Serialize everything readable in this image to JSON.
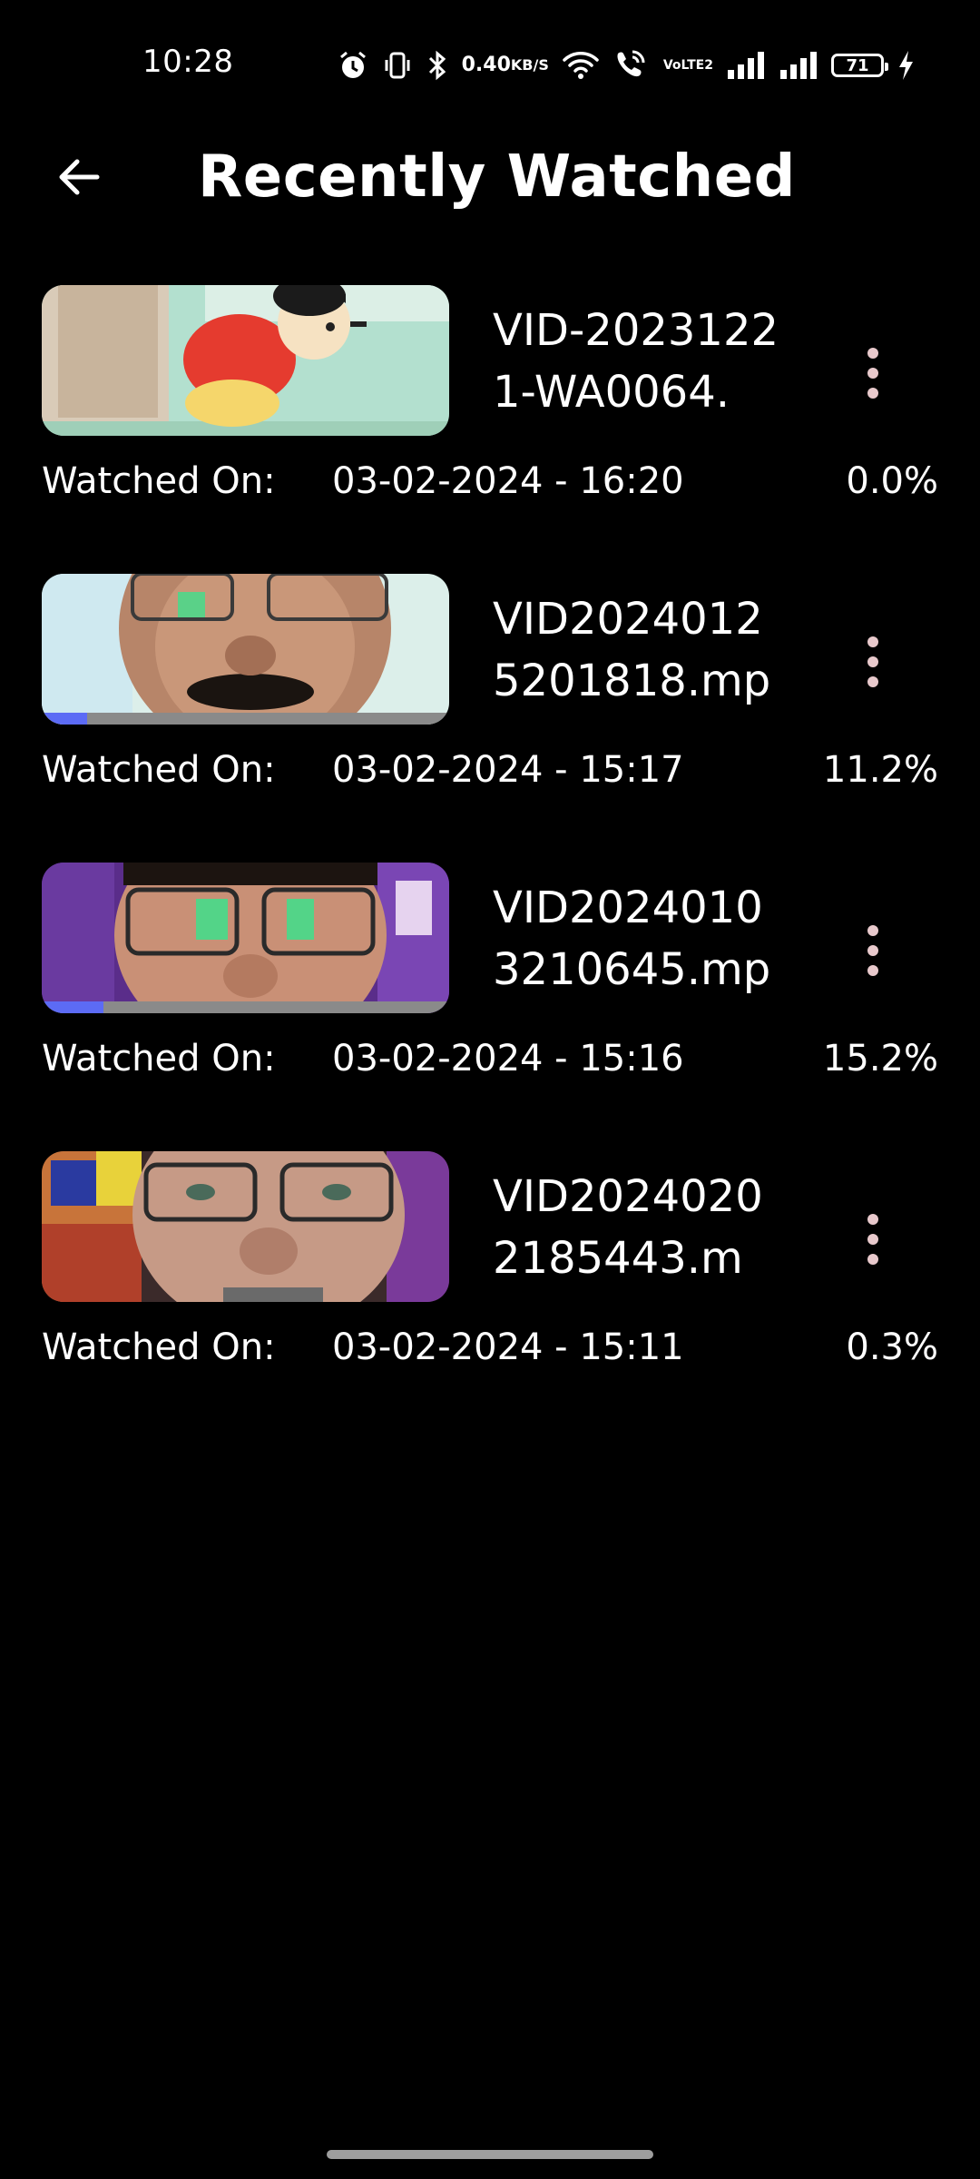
{
  "status_bar": {
    "time": "10:28",
    "net_speed_value": "0.40",
    "net_speed_unit": "KB/S",
    "volte_top": "Vo",
    "volte_bottom": "LTE2",
    "battery": "71",
    "icons": [
      "alarm-icon",
      "vibrate-icon",
      "bluetooth-icon",
      "wifi-icon",
      "wifi-calling-icon",
      "signal-icon",
      "signal-icon",
      "charging-icon"
    ]
  },
  "header": {
    "back_icon": "arrow-left-icon",
    "title": "Recently Watched"
  },
  "colors": {
    "background": "#000000",
    "text": "#ffffff",
    "progress_fill": "#5c6bf5",
    "progress_track": "#8a8a8a",
    "menu_dots": "#e8c9cc"
  },
  "videos": [
    {
      "name": "VID-20231221-WA0064.",
      "watched_label": "Watched On:",
      "watched_on": "03-02-2024 - 16:20",
      "percent_label": "0.0%",
      "progress": 0.0,
      "thumbnail": "cartoon-scene"
    },
    {
      "name": "VID20240125201818.mp",
      "watched_label": "Watched On:",
      "watched_on": "03-02-2024 - 15:17",
      "percent_label": "11.2%",
      "progress": 0.112,
      "thumbnail": "face-selfie"
    },
    {
      "name": "VID20240103210645.mp",
      "watched_label": "Watched On:",
      "watched_on": "03-02-2024 - 15:16",
      "percent_label": "15.2%",
      "progress": 0.152,
      "thumbnail": "face-selfie"
    },
    {
      "name": "VID20240202185443.m",
      "watched_label": "Watched On:",
      "watched_on": "03-02-2024 - 15:11",
      "percent_label": "0.3%",
      "progress": 0.003,
      "thumbnail": "face-selfie"
    }
  ]
}
